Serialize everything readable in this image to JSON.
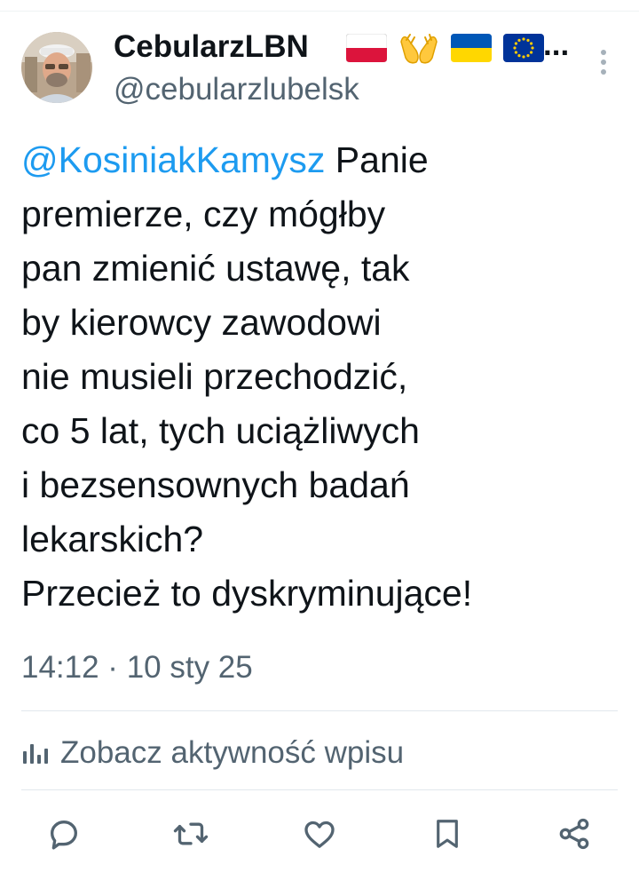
{
  "author": {
    "display_name": "CebularzLBN",
    "name_ellipsis": "...",
    "handle": "@cebularzlubelsk",
    "badges": [
      "poland-flag-icon",
      "open-hands-icon",
      "ukraine-flag-icon",
      "eu-flag-icon"
    ]
  },
  "tweet": {
    "mention": "@KosiniakKamysz",
    "line_1_rest": " Panie",
    "lines": [
      "premierze, czy mógłby",
      "pan zmienić ustawę, tak",
      "by kierowcy zawodowi",
      "nie musieli przechodzić,",
      "co 5 lat, tych uciążliwych",
      "i bezsensownych badań",
      "lekarskich?",
      "Przecież to dyskryminujące!"
    ],
    "timestamp": "14:12 · 10 sty 25"
  },
  "activity": {
    "label": "Zobacz aktywność wpisu",
    "icon": "analytics-icon"
  },
  "actions": [
    "reply-icon",
    "retweet-icon",
    "like-icon",
    "bookmark-icon",
    "share-icon"
  ],
  "colors": {
    "text": "#0f1419",
    "secondary": "#536471",
    "mention": "#1d9bf0",
    "divider": "#e1e8ed"
  }
}
